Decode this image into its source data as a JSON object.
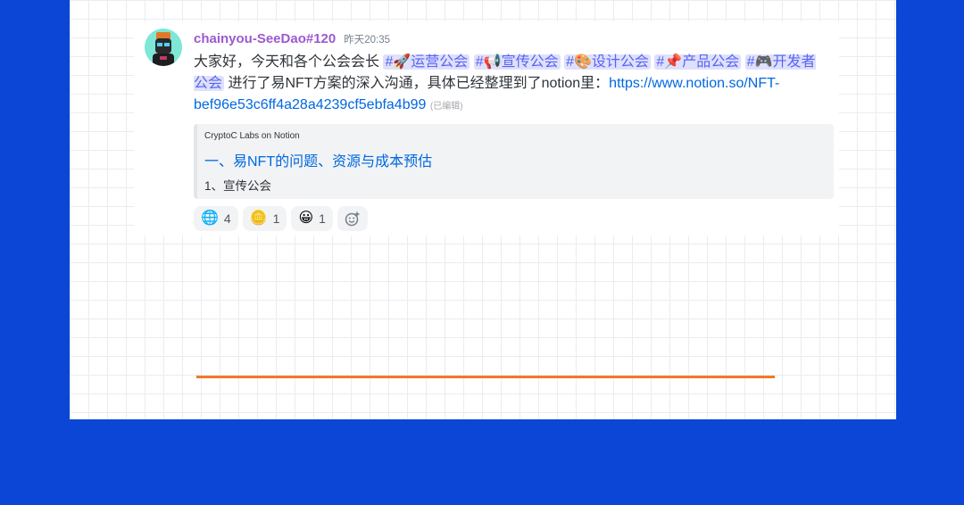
{
  "message": {
    "author": "chainyou-SeeDao#120",
    "timestamp": "昨天20:35",
    "text_intro": "大家好，今天和各个公会会长",
    "channels": [
      {
        "hash": "#",
        "emoji": "🚀",
        "name": "运营公会"
      },
      {
        "hash": "#",
        "emoji": "📢",
        "name": "宣传公会"
      },
      {
        "hash": "#",
        "emoji": "🎨",
        "name": "设计公会"
      },
      {
        "hash": "#",
        "emoji": "📌",
        "name": "产品公会"
      },
      {
        "hash": "#",
        "emoji": "🎮",
        "name": "开发者公会"
      }
    ],
    "text_after": "进行了易NFT方案的深入沟通，具体已经整理到了notion里：",
    "link": "https://www.notion.so/NFT-bef96e53c6ff4a28a4239cf5ebfa4b99",
    "edited": "(已编辑)"
  },
  "embed": {
    "provider": "CryptoC Labs on Notion",
    "title": "一、易NFT的问题、资源与成本预估",
    "description": "1、宣传公会"
  },
  "reactions": [
    {
      "icon": "globe-icon",
      "emoji": "🌐",
      "count": "4"
    },
    {
      "icon": "coin-icon",
      "emoji": "🪙",
      "count": "1"
    },
    {
      "icon": "grin-icon",
      "emoji": "😀",
      "count": "1"
    }
  ],
  "colors": {
    "page_background": "#0b46d6",
    "username": "#9b59d0",
    "link": "#0068e0",
    "mention_bg": "#dee0fc",
    "accent_line": "#f0792b"
  }
}
